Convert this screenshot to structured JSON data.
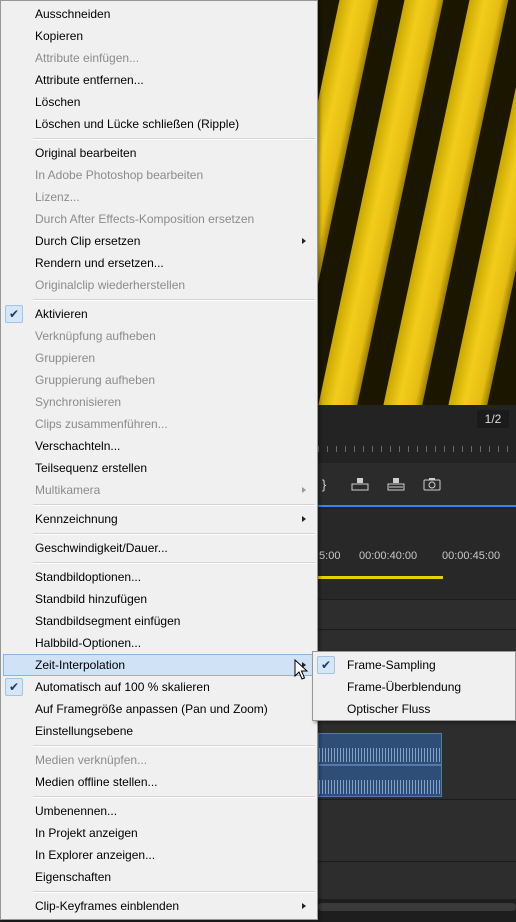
{
  "preview": {
    "page_indicator": "1/2"
  },
  "timeline": {
    "time_labels": [
      ":5:00",
      "00:00:40:00",
      "00:00:45:00"
    ]
  },
  "transport_icons": [
    "bracket-icon",
    "lift-icon",
    "extract-icon",
    "camera-icon"
  ],
  "menu": {
    "groups": [
      [
        "Ausschneiden",
        "Kopieren",
        "Attribute einfügen...",
        "Attribute entfernen...",
        "Löschen",
        "Löschen und Lücke schließen (Ripple)"
      ],
      [
        "Original bearbeiten",
        "In Adobe Photoshop bearbeiten",
        "Lizenz...",
        "Durch After Effects-Komposition ersetzen",
        "Durch Clip ersetzen",
        "Rendern und ersetzen...",
        "Originalclip wiederherstellen"
      ],
      [
        "Aktivieren",
        "Verknüpfung aufheben",
        "Gruppieren",
        "Gruppierung aufheben",
        "Synchronisieren",
        "Clips zusammenführen...",
        "Verschachteln...",
        "Teilsequenz erstellen",
        "Multikamera"
      ],
      [
        "Kennzeichnung"
      ],
      [
        "Geschwindigkeit/Dauer..."
      ],
      [
        "Standbildoptionen...",
        "Standbild hinzufügen",
        "Standbildsegment einfügen",
        "Halbbild-Optionen...",
        "Zeit-Interpolation",
        "Automatisch auf 100 % skalieren",
        "Auf Framegröße anpassen (Pan und Zoom)",
        "Einstellungsebene"
      ],
      [
        "Medien verknüpfen...",
        "Medien offline stellen..."
      ],
      [
        "Umbenennen...",
        "In Projekt anzeigen",
        "In Explorer anzeigen...",
        "Eigenschaften"
      ],
      [
        "Clip-Keyframes einblenden"
      ]
    ]
  },
  "submenu": {
    "items": [
      "Frame-Sampling",
      "Frame-Überblendung",
      "Optischer Fluss"
    ]
  },
  "colors": {
    "menu_bg": "#f0f0f0",
    "highlight": "#cfe2f6",
    "accent": "#2d8ceb",
    "work_area": "#e8d100"
  }
}
